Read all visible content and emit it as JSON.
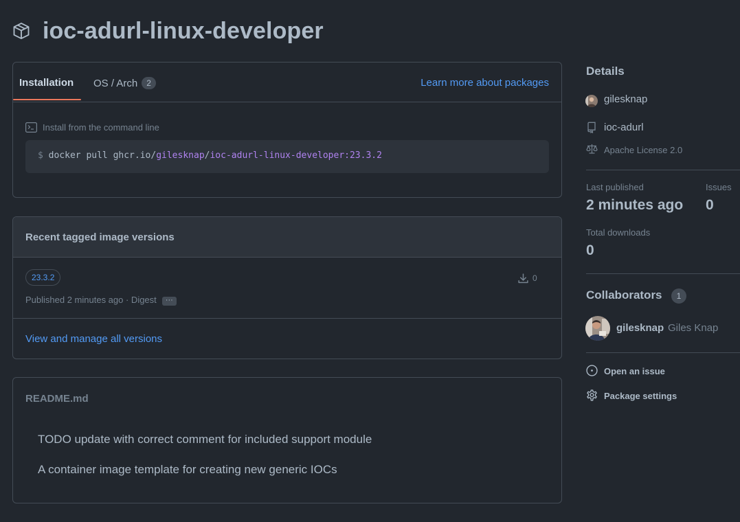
{
  "package": {
    "name": "ioc-adurl-linux-developer",
    "icon": "package-icon"
  },
  "install": {
    "tabs": [
      {
        "label": "Installation"
      },
      {
        "label": "OS / Arch",
        "count": "2"
      }
    ],
    "learn_more": "Learn more about packages",
    "cmd_label": "Install from the command line",
    "cmd_prompt": "$",
    "cmd_prefix": "docker pull ghcr.io/",
    "cmd_owner": "gilesknap",
    "cmd_slash": "/",
    "cmd_image": "ioc-adurl-linux-developer:23.3.2"
  },
  "versions": {
    "title": "Recent tagged image versions",
    "items": [
      {
        "tag": "23.3.2",
        "published": "Published 2 minutes ago · Digest",
        "downloads": "0"
      }
    ],
    "view_all": "View and manage all versions"
  },
  "readme": {
    "title": "README.md",
    "paragraphs": [
      "TODO update with correct comment for included support module",
      "A container image template for creating new generic IOCs"
    ]
  },
  "sidebar": {
    "details_heading": "Details",
    "owner": "gilesknap",
    "repo": "ioc-adurl",
    "license": "Apache License 2.0",
    "last_published_label": "Last published",
    "last_published_value": "2 minutes ago",
    "issues_label": "Issues",
    "issues_value": "0",
    "downloads_label": "Total downloads",
    "downloads_value": "0",
    "collaborators_heading": "Collaborators",
    "collaborators_count": "1",
    "collaborators": [
      {
        "login": "gilesknap",
        "name": "Giles Knap"
      }
    ],
    "actions": {
      "open_issue": "Open an issue",
      "package_settings": "Package settings"
    }
  },
  "colors": {
    "background": "#22272e",
    "accent_link": "#539bf5",
    "tab_underline": "#ec775c",
    "command_highlight": "#b083f0",
    "border": "#444c56"
  }
}
